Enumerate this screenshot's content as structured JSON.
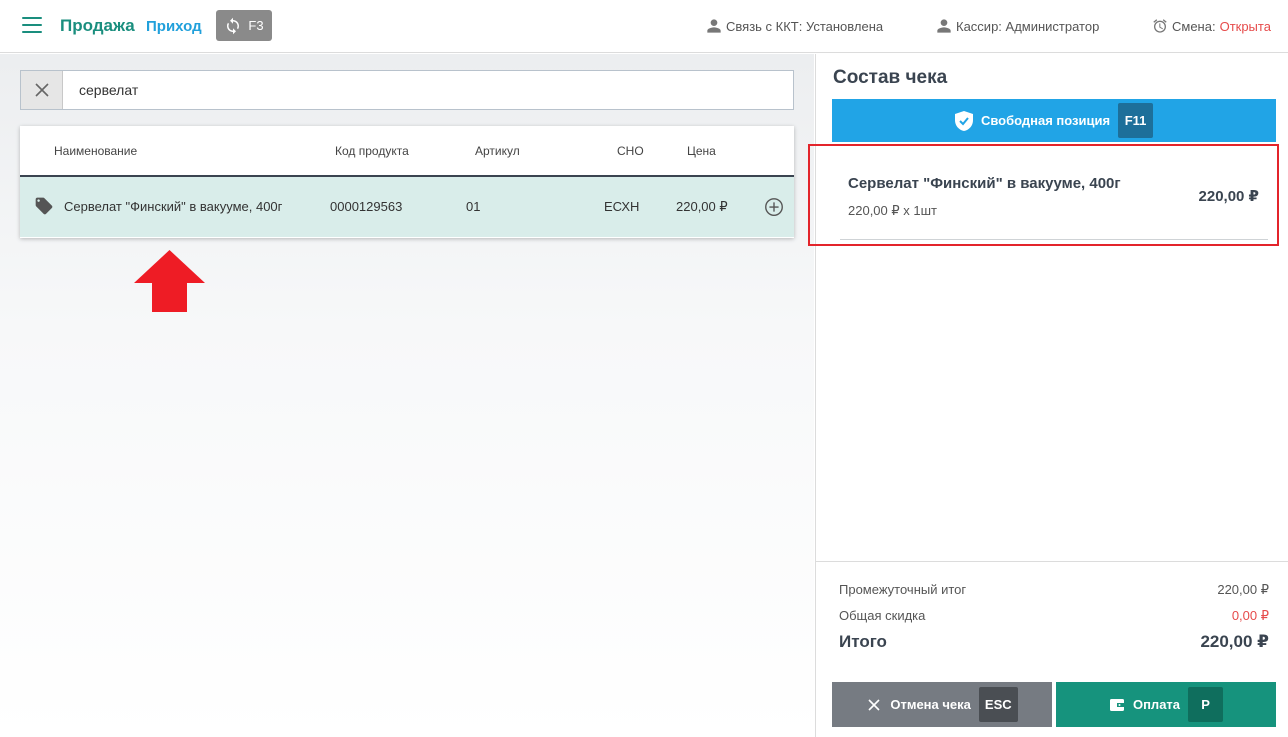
{
  "header": {
    "tab_sale": "Продажа",
    "tab_income": "Приход",
    "sync_key": "F3",
    "kkt_status": "Связь с ККТ: Установлена",
    "cashier": "Кассир: Администратор",
    "shift_label": "Смена:",
    "shift_value": "Открыта"
  },
  "search": {
    "value": "сервелат"
  },
  "table": {
    "columns": [
      "Наименование",
      "Код продукта",
      "Артикул",
      "СНО",
      "Цена"
    ],
    "rows": [
      {
        "name": "Сервелат \"Финский\" в вакууме, 400г",
        "code": "0000129563",
        "article": "01",
        "sno": "ЕСХН",
        "price": "220,00 ₽"
      }
    ]
  },
  "receipt": {
    "title": "Состав чека",
    "free_position_label": "Свободная позиция",
    "free_position_key": "F11",
    "items": [
      {
        "name": "Сервелат \"Финский\" в вакууме, 400г",
        "qty_line": "220,00 ₽ x 1шт",
        "price": "220,00 ₽"
      }
    ],
    "subtotal_label": "Промежуточный итог",
    "subtotal_value": "220,00 ₽",
    "discount_label": "Общая скидка",
    "discount_value": "0,00 ₽",
    "total_label": "Итого",
    "total_value": "220,00 ₽",
    "cancel_label": "Отмена чека",
    "cancel_key": "ESC",
    "pay_label": "Оплата",
    "pay_key": "P"
  },
  "icons": {
    "menu": "hamburger-icon",
    "sync": "sync-icon",
    "user": "user-icon",
    "alarm": "alarm-clock-icon",
    "clear": "close-icon",
    "tag": "tag-icon",
    "add": "plus-circle-icon",
    "shield": "shield-check-icon",
    "wallet": "wallet-icon"
  },
  "colors": {
    "brand_green": "#1a8e7e",
    "accent_blue": "#21a4e6",
    "danger": "#e64b4b",
    "row_highlight": "#d9edea"
  }
}
